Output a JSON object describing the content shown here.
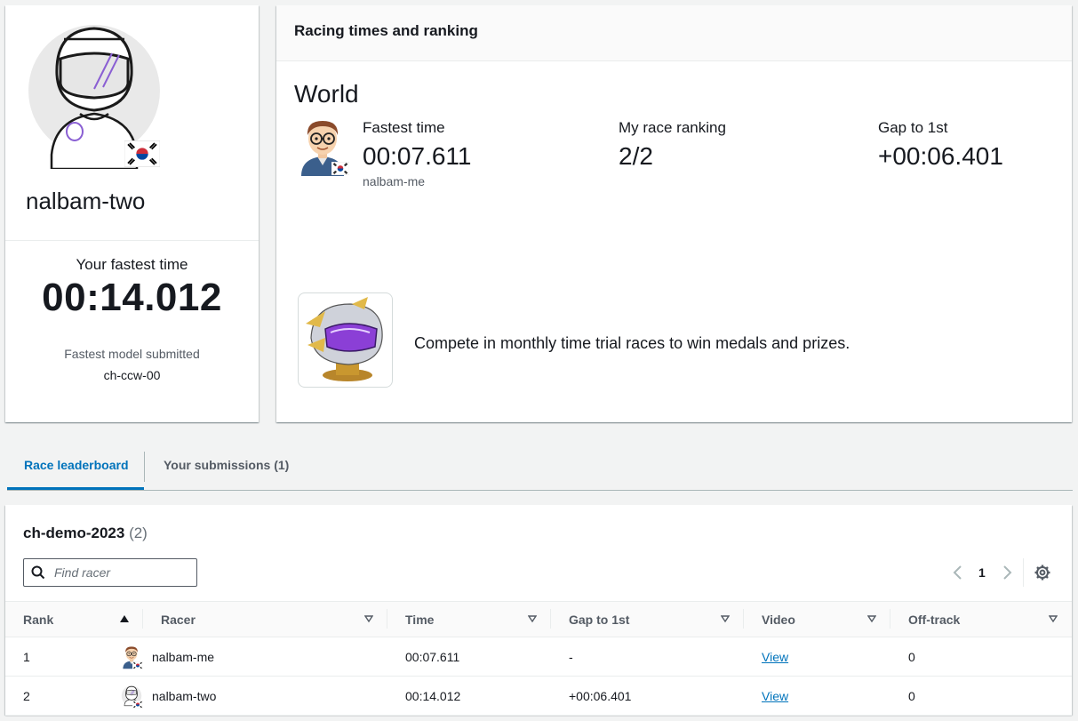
{
  "profile": {
    "name": "nalbam-two",
    "fastest_label": "Your fastest time",
    "fastest_time": "00:14.012",
    "model_label": "Fastest model submitted",
    "model_name": "ch-ccw-00",
    "avatar_icon": "helmet-avatar-icon",
    "flag_icon": "korea-flag-icon"
  },
  "racing": {
    "header": "Racing times and ranking",
    "scope": "World",
    "fastest_label": "Fastest time",
    "fastest_value": "00:07.611",
    "fastest_racer": "nalbam-me",
    "ranking_label": "My race ranking",
    "ranking_value": "2/2",
    "gap_label": "Gap to 1st",
    "gap_value": "+00:06.401",
    "promo": "Compete in monthly time trial races to win medals and prizes."
  },
  "tabs": [
    {
      "label": "Race leaderboard",
      "active": true
    },
    {
      "label": "Your submissions (1)",
      "active": false
    }
  ],
  "leaderboard": {
    "title": "ch-demo-2023",
    "count": "(2)",
    "search_placeholder": "Find racer",
    "page": "1",
    "columns": [
      "Rank",
      "Racer",
      "Time",
      "Gap to 1st",
      "Video",
      "Off-track"
    ],
    "rows": [
      {
        "rank": "1",
        "racer": "nalbam-me",
        "time": "00:07.611",
        "gap": "-",
        "video": "View",
        "offtrack": "0"
      },
      {
        "rank": "2",
        "racer": "nalbam-two",
        "time": "00:14.012",
        "gap": "+00:06.401",
        "video": "View",
        "offtrack": "0"
      }
    ]
  },
  "colors": {
    "link": "#0073bb",
    "text": "#16191f",
    "muted": "#545b64",
    "background": "#f2f3f3"
  }
}
